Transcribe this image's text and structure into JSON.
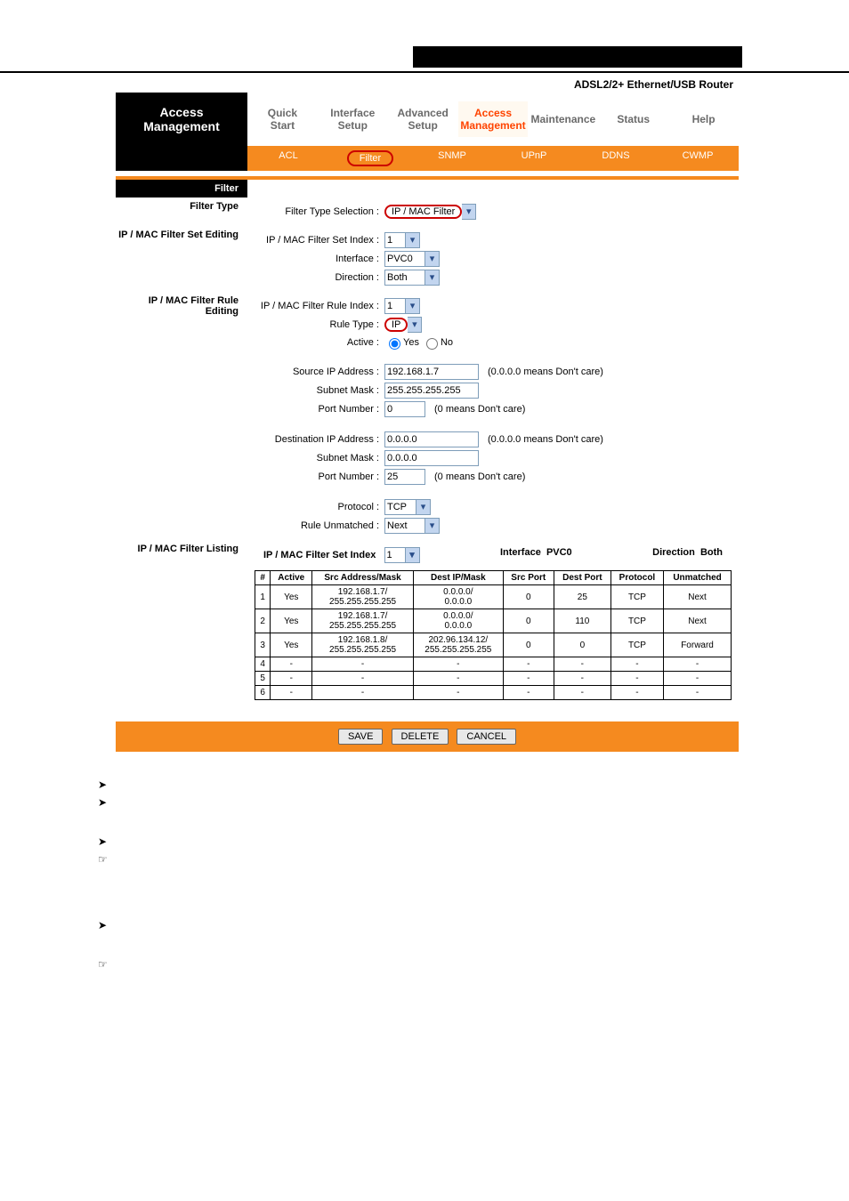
{
  "router_label": "ADSL2/2+ Ethernet/USB Router",
  "brand": {
    "line1": "Access",
    "line2": "Management"
  },
  "tabs": [
    "Quick\nStart",
    "Interface\nSetup",
    "Advanced\nSetup",
    "Access\nManagement",
    "Maintenance",
    "Status",
    "Help"
  ],
  "subtabs": [
    "ACL",
    "Filter",
    "SNMP",
    "UPnP",
    "DDNS",
    "CWMP"
  ],
  "section_filter": "Filter",
  "section_filter_type": "Filter Type",
  "filter_type_label": "Filter Type Selection :",
  "filter_type_value": "IP / MAC Filter",
  "section_set_edit": "IP / MAC Filter Set Editing",
  "set_index_label": "IP / MAC Filter Set Index :",
  "set_index_value": "1",
  "iface_label": "Interface :",
  "iface_value": "PVC0",
  "dir_label": "Direction :",
  "dir_value": "Both",
  "section_rule_edit": "IP / MAC Filter Rule Editing",
  "rule_index_label": "IP / MAC Filter Rule Index :",
  "rule_index_value": "1",
  "rule_type_label": "Rule Type :",
  "rule_type_value": "IP",
  "active_label": "Active :",
  "active_yes": "Yes",
  "active_no": "No",
  "src_ip_label": "Source IP Address :",
  "src_ip_value": "192.168.1.7",
  "src_ip_hint": "(0.0.0.0 means Don't care)",
  "src_mask_label": "Subnet Mask :",
  "src_mask_value": "255.255.255.255",
  "src_port_label": "Port Number :",
  "src_port_value": "0",
  "src_port_hint": "(0 means Don't care)",
  "dst_ip_label": "Destination IP Address :",
  "dst_ip_value": "0.0.0.0",
  "dst_ip_hint": "(0.0.0.0 means Don't care)",
  "dst_mask_label": "Subnet Mask :",
  "dst_mask_value": "0.0.0.0",
  "dst_port_label": "Port Number :",
  "dst_port_value": "25",
  "dst_port_hint": "(0 means Don't care)",
  "proto_label": "Protocol :",
  "proto_value": "TCP",
  "unmatched_label": "Rule Unmatched :",
  "unmatched_value": "Next",
  "section_listing": "IP / MAC Filter Listing",
  "listing_top": {
    "set_index": "IP / MAC Filter Set Index",
    "set_index_val": "1",
    "iface": "Interface",
    "iface_val": "PVC0",
    "dir": "Direction",
    "dir_val": "Both"
  },
  "table": {
    "headers": [
      "#",
      "Active",
      "Src Address/Mask",
      "Dest IP/Mask",
      "Src Port",
      "Dest Port",
      "Protocol",
      "Unmatched"
    ],
    "rows": [
      [
        "1",
        "Yes",
        "192.168.1.7/\n255.255.255.255",
        "0.0.0.0/\n0.0.0.0",
        "0",
        "25",
        "TCP",
        "Next"
      ],
      [
        "2",
        "Yes",
        "192.168.1.7/\n255.255.255.255",
        "0.0.0.0/\n0.0.0.0",
        "0",
        "110",
        "TCP",
        "Next"
      ],
      [
        "3",
        "Yes",
        "192.168.1.8/\n255.255.255.255",
        "202.96.134.12/\n255.255.255.255",
        "0",
        "0",
        "TCP",
        "Forward"
      ],
      [
        "4",
        "-",
        "-",
        "-",
        "-",
        "-",
        "-",
        "-"
      ],
      [
        "5",
        "-",
        "-",
        "-",
        "-",
        "-",
        "-",
        "-"
      ],
      [
        "6",
        "-",
        "-",
        "-",
        "-",
        "-",
        "-",
        "-"
      ]
    ]
  },
  "buttons": {
    "save": "SAVE",
    "delete": "DELETE",
    "cancel": "CANCEL"
  }
}
